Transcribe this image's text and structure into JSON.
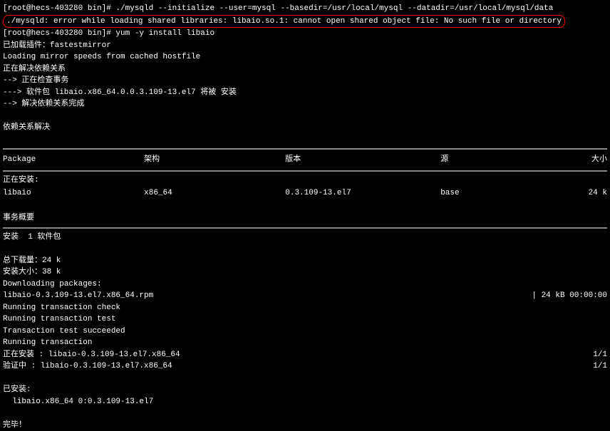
{
  "prompt1": "[root@hecs-403280 bin]# ./mysqld --initialize --user=mysql --basedir=/usr/local/mysql --datadir=/usr/local/mysql/data",
  "error_msg": "./mysqld: error while loading shared libraries: libaio.so.1: cannot open shared object file: No such file or directory",
  "prompt2": "[root@hecs-403280 bin]# yum -y install libaio",
  "lines": {
    "plugin": "已加载插件：fastestmirror",
    "loading": "Loading mirror speeds from cached hostfile",
    "resolving_deps": "正在解决依赖关系",
    "checking": "--> 正在检查事务",
    "package_install": "---> 软件包 libaio.x86_64.0.0.3.109-13.el7 将被 安装",
    "resolved": "--> 解决依赖关系完成",
    "deps_resolved_header": "依赖关系解决",
    "installing": "正在安装:",
    "summary": "事务概要",
    "install_count": "安装  1 软件包",
    "total_download": "总下载量：24 k",
    "install_size": "安装大小：38 k",
    "downloading": "Downloading packages:",
    "rpm_file": "libaio-0.3.109-13.el7.x86_64.rpm",
    "download_status": "|  24 kB  00:00:00",
    "running_check": "Running transaction check",
    "running_test": "Running transaction test",
    "test_succeeded": "Transaction test succeeded",
    "running_trans": "Running transaction",
    "installing_pkg": "  正在安装    : libaio-0.3.109-13.el7.x86_64",
    "verifying_pkg": "  验证中      : libaio-0.3.109-13.el7.x86_64",
    "fraction": "1/1",
    "installed": "已安装:",
    "installed_pkg": "  libaio.x86_64 0:0.3.109-13.el7",
    "complete": "完毕！"
  },
  "table": {
    "headers": {
      "package": " Package",
      "arch": "架构",
      "version": "版本",
      "repo": "源",
      "size": "大小"
    },
    "row": {
      "package": " libaio",
      "arch": "x86_64",
      "version": "0.3.109-13.el7",
      "repo": "base",
      "size": "24 k"
    }
  }
}
